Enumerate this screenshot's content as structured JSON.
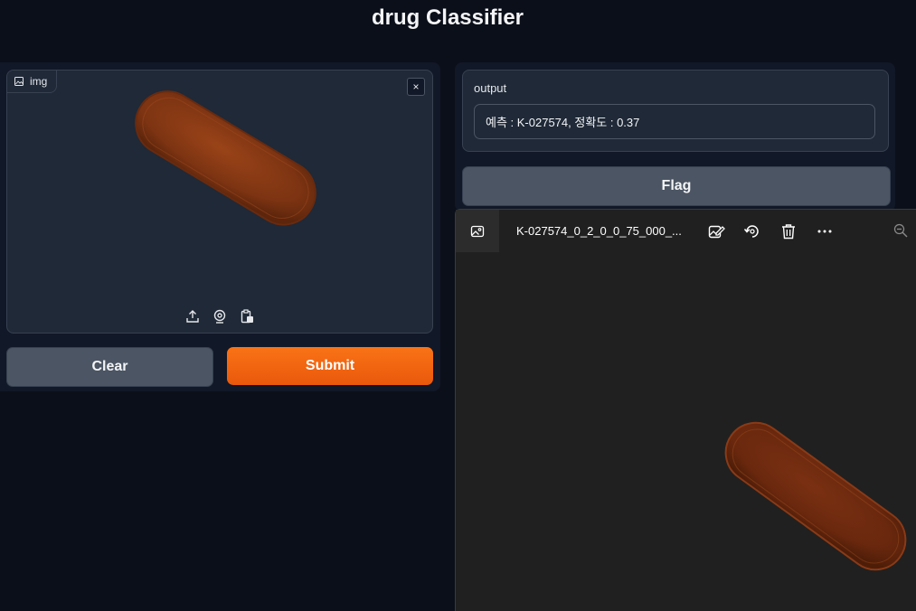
{
  "app": {
    "title": "drug Classifier"
  },
  "input": {
    "label": "img",
    "close": "×",
    "tools": [
      "upload-icon",
      "webcam-icon",
      "clipboard-icon"
    ]
  },
  "buttons": {
    "clear": "Clear",
    "submit": "Submit",
    "flag": "Flag"
  },
  "output": {
    "label": "output",
    "value": "예측 : K-027574, 정확도 : 0.37"
  },
  "viewer": {
    "filename": "K-027574_0_2_0_0_75_000_...",
    "actions": [
      "edit-image-icon",
      "rotate-icon",
      "delete-icon",
      "more-icon"
    ],
    "zoom": "zoom-out-icon"
  },
  "colors": {
    "background": "#0b0f19",
    "panel": "#111827",
    "block": "#1f2937",
    "accent": "#f97316",
    "secondary_button": "#4b5563",
    "pill": "#8a3a16",
    "viewer_bg": "#202020"
  }
}
